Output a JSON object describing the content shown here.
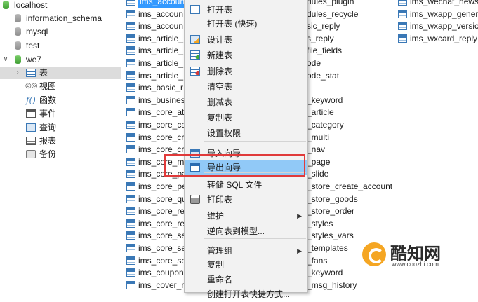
{
  "tree": {
    "connection": "localhost",
    "databases": [
      "information_schema",
      "mysql",
      "test"
    ],
    "open_db": "we7",
    "open_db_items": [
      {
        "label": "表",
        "icon": "table-icon"
      },
      {
        "label": "视图",
        "icon": "view-icon"
      },
      {
        "label": "函数",
        "icon": "function-icon"
      },
      {
        "label": "事件",
        "icon": "event-icon"
      },
      {
        "label": "查询",
        "icon": "query-icon"
      },
      {
        "label": "报表",
        "icon": "report-icon"
      },
      {
        "label": "备份",
        "icon": "backup-icon"
      }
    ]
  },
  "tables": {
    "col1": [
      "ims_account",
      "ims_accoun",
      "ims_accoun",
      "ims_article_",
      "ims_article_",
      "ims_article_",
      "ims_article_",
      "ims_basic_r",
      "ims_busines",
      "ims_core_at",
      "ims_core_ca",
      "ims_core_cr",
      "ims_core_cr",
      "ims_core_m",
      "ims_core_pa",
      "ims_core_pe",
      "ims_core_qu",
      "ims_core_re",
      "ims_core_re",
      "ims_core_se",
      "ims_core_se",
      "ims_core_se",
      "ims_coupon",
      "ims_cover_r"
    ],
    "col2": [
      "dules_plugin",
      "dules_recycle",
      "sic_reply",
      "s_reply",
      "file_fields",
      "ode",
      "ode_stat",
      "",
      "_keyword",
      "_article",
      "_category",
      "_multi",
      "_nav",
      "_page",
      "_slide",
      "_store_create_account",
      "_store_goods",
      "_store_order",
      "_styles",
      "_styles_vars",
      "_templates",
      "_fans",
      "_keyword",
      "_msg_history"
    ],
    "col3": [
      "ims_wechat_news",
      "ims_wxapp_gener",
      "ims_wxapp_versic",
      "ims_wxcard_reply"
    ]
  },
  "menu": {
    "items": [
      {
        "label": "打开表",
        "icon": "open-table-icon",
        "sub": false
      },
      {
        "label": "打开表 (快速)",
        "icon": "",
        "sub": false
      },
      {
        "label": "设计表",
        "icon": "design-table-icon",
        "sub": false
      },
      {
        "label": "新建表",
        "icon": "new-table-icon",
        "sub": false
      },
      {
        "label": "删除表",
        "icon": "delete-table-icon",
        "sub": false
      },
      {
        "label": "清空表",
        "icon": "",
        "sub": false
      },
      {
        "label": "删减表",
        "icon": "",
        "sub": false
      },
      {
        "label": "复制表",
        "icon": "",
        "sub": false
      },
      {
        "label": "设置权限",
        "icon": "",
        "sub": false
      },
      {
        "label": "导入向导",
        "icon": "import-wizard-icon",
        "sub": false
      },
      {
        "label": "导出向导",
        "icon": "export-wizard-icon",
        "sub": false
      },
      {
        "label": "转储 SQL 文件",
        "icon": "",
        "sub": false
      },
      {
        "label": "打印表",
        "icon": "print-icon",
        "sub": false
      },
      {
        "label": "维护",
        "icon": "",
        "sub": true
      },
      {
        "label": "逆向表到模型...",
        "icon": "",
        "sub": false
      },
      {
        "label": "管理组",
        "icon": "",
        "sub": true
      },
      {
        "label": "复制",
        "icon": "",
        "sub": false
      },
      {
        "label": "重命名",
        "icon": "",
        "sub": false
      },
      {
        "label": "创建打开表快捷方式...",
        "icon": "",
        "sub": false
      }
    ],
    "highlighted": "导出向导"
  },
  "watermark": {
    "brand": "酷知网",
    "url": "www.coozhi.com"
  },
  "colors": {
    "selection": "#3399ff",
    "menu_hover": "#91c9f7",
    "callout": "#e03a3a",
    "logo": "#f5a623"
  }
}
